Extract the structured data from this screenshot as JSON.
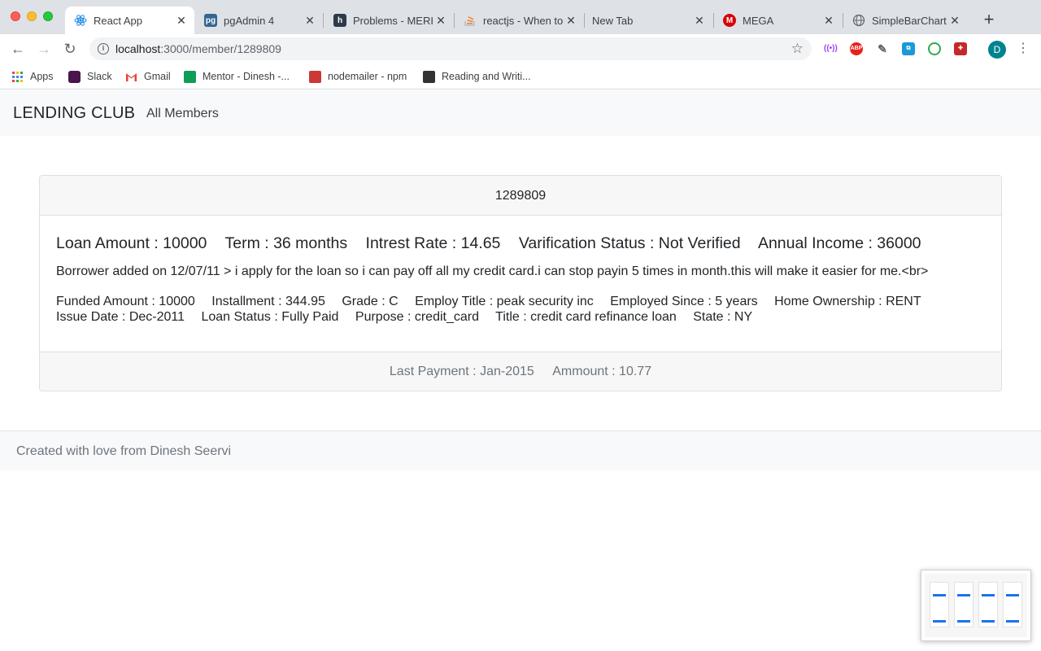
{
  "browser": {
    "tabs": [
      {
        "title": "React App",
        "active": true,
        "icon": "react-icon"
      },
      {
        "title": "pgAdmin 4",
        "active": false,
        "icon": "pgadmin-icon"
      },
      {
        "title": "Problems - MERI",
        "active": false,
        "icon": "hackerrank-icon"
      },
      {
        "title": "reactjs - When to",
        "active": false,
        "icon": "stackoverflow-icon"
      },
      {
        "title": "New Tab",
        "active": false,
        "icon": ""
      },
      {
        "title": "MEGA",
        "active": false,
        "icon": "mega-icon"
      },
      {
        "title": "SimpleBarChart",
        "active": false,
        "icon": "globe-icon"
      }
    ],
    "url_host": "localhost",
    "url_path": ":3000/member/1289809",
    "profile_initial": "D",
    "bookmarks": [
      {
        "label": "Apps",
        "icon": "apps-grid-icon"
      },
      {
        "label": "Slack",
        "icon": "slack-icon"
      },
      {
        "label": "Gmail",
        "icon": "gmail-icon"
      },
      {
        "label": "Mentor - Dinesh -...",
        "icon": "sheets-icon"
      },
      {
        "label": "nodemailer - npm",
        "icon": "npm-icon"
      },
      {
        "label": "Reading and Writi...",
        "icon": "sa-icon"
      }
    ]
  },
  "navbar": {
    "brand": "LENDING CLUB",
    "link": "All Members"
  },
  "member": {
    "id": "1289809",
    "loan_amount": "Loan Amount : 10000",
    "term": "Term : 36 months",
    "interest_rate": "Intrest Rate : 14.65",
    "verification_status": "Varification Status : Not Verified",
    "annual_income": "Annual Income : 36000",
    "description": "Borrower added on 12/07/11 > i apply for the loan so i can pay off all my credit card.i can stop payin 5 times in month.this will make it easier for me.<br>",
    "funded_amount": "Funded Amount : 10000",
    "installment": "Installment : 344.95",
    "grade": "Grade : C",
    "employ_title": "Employ Title : peak security inc",
    "employed_since": "Employed Since : 5 years",
    "home_ownership": "Home Ownership : RENT",
    "issue_date": "Issue Date : Dec-2011",
    "loan_status": "Loan Status : Fully Paid",
    "purpose": "Purpose : credit_card",
    "title": "Title : credit card refinance loan",
    "state": "State : NY",
    "last_payment": "Last Payment : Jan-2015",
    "amount": "Ammount : 10.77"
  },
  "footer": {
    "text": "Created with love from Dinesh Seervi"
  },
  "colors": {
    "navbar_bg": "#f8f9fa",
    "card_header_bg": "#f7f7f7",
    "muted_text": "#6c757d"
  }
}
